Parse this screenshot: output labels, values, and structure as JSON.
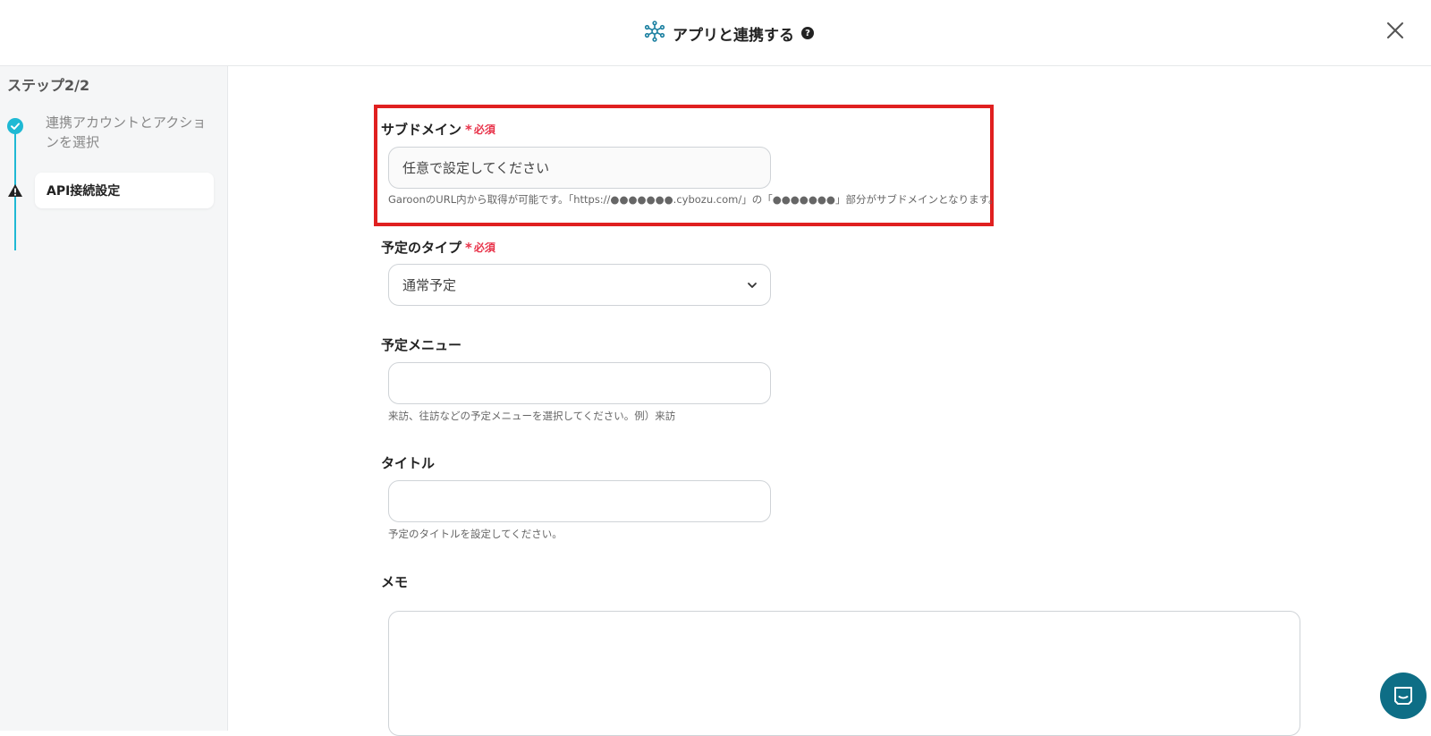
{
  "header": {
    "title": "アプリと連携する",
    "help_glyph": "?"
  },
  "sidebar": {
    "step_title": "ステップ2/2",
    "steps": [
      {
        "label": "連携アカウントとアクションを選択",
        "status": "done"
      },
      {
        "label": "API接続設定",
        "status": "warning"
      }
    ],
    "accent_color": "#1fb9d4"
  },
  "form": {
    "required_text": "必須",
    "subdomain": {
      "label": "サブドメイン",
      "placeholder": "任意で設定してください",
      "help": "GaroonのURL内から取得が可能です。「https://●●●●●●●.cybozu.com/」の「●●●●●●●」部分がサブドメインとなります。"
    },
    "schedule_type": {
      "label": "予定のタイプ",
      "selected": "通常予定"
    },
    "schedule_menu": {
      "label": "予定メニュー",
      "value": "",
      "help": "来訪、往訪などの予定メニューを選択してください。例）来訪"
    },
    "title": {
      "label": "タイトル",
      "value": "",
      "help": "予定のタイトルを設定してください。"
    },
    "memo": {
      "label": "メモ",
      "value": ""
    }
  },
  "colors": {
    "highlight_border": "#e02020",
    "required": "#e8334a",
    "chat_button": "#0e6e86"
  },
  "icons": {
    "header": "network-hub-icon",
    "close": "close-icon",
    "step_done": "check-circle-icon",
    "step_warning": "warning-icon",
    "select": "chevron-down-icon",
    "chat": "chat-icon"
  }
}
